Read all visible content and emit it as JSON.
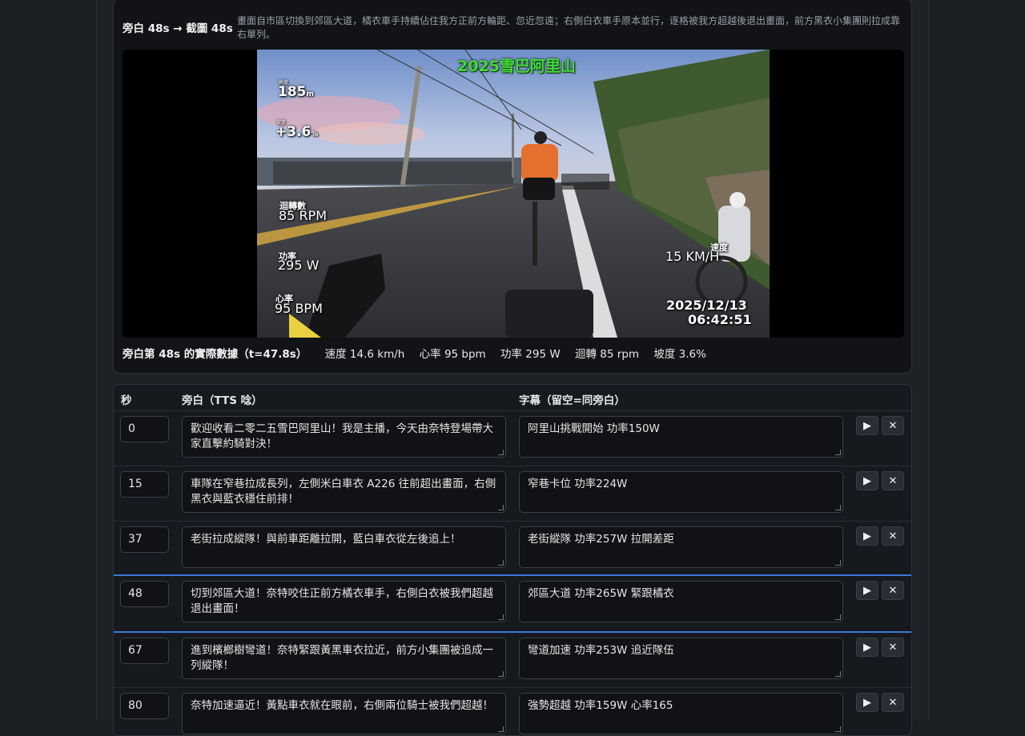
{
  "preview": {
    "title": "旁白 48s → 截圖 48s",
    "description": "畫面自市區切換到郊區大道，橘衣車手持續佔住我方正前方輪距、忽近忽遠；右側白衣車手原本並行，逐格被我方超越後退出畫面，前方黑衣小集團則拉成靠右單列。",
    "overlay": {
      "event_title": "2025雪巴阿里山",
      "altitude_label": "高度",
      "altitude_value": "185",
      "altitude_unit": "m",
      "grade_label": "坡度",
      "grade_value": "+3.6",
      "grade_unit": "%",
      "cadence_label": "迴轉數",
      "cadence_value": "85",
      "cadence_unit": "RPM",
      "power_label": "功率",
      "power_value": "295",
      "power_unit": "W",
      "hr_label": "心率",
      "hr_value": "95",
      "hr_unit": "BPM",
      "speed_label": "速度",
      "speed_value": "15",
      "speed_unit": "KM/H",
      "date": "2025/12/13",
      "time": "06:42:51"
    },
    "actual": {
      "label": "旁白第 48s 的實際數據（t=47.8s）",
      "speed": "速度 14.6 km/h",
      "hr": "心率 95 bpm",
      "power": "功率 295 W",
      "cadence": "迴轉 85 rpm",
      "grade": "坡度 3.6%"
    }
  },
  "table": {
    "headers": {
      "sec": "秒",
      "narration": "旁白（TTS 唸）",
      "subtitle": "字幕（留空=同旁白）"
    },
    "play_icon": "▶",
    "delete_icon": "✕",
    "rows": [
      {
        "sec": "0",
        "narration": "歡迎收看二零二五雪巴阿里山！我是主播，今天由奈特登場帶大家直擊約騎對決！",
        "subtitle": "阿里山挑戰開始 功率150W"
      },
      {
        "sec": "15",
        "narration": "車隊在窄巷拉成長列，左側米白車衣 A226 往前超出畫面，右側黑衣與藍衣穩住前排！",
        "subtitle": "窄巷卡位 功率224W"
      },
      {
        "sec": "37",
        "narration": "老街拉成縱隊！與前車距離拉開，藍白車衣從左後追上！",
        "subtitle": "老街縱隊 功率257W 拉開差距"
      },
      {
        "sec": "48",
        "narration": "切到郊區大道！奈特咬住正前方橘衣車手，右側白衣被我們超越退出畫面！",
        "subtitle": "郊區大道 功率265W 緊跟橘衣"
      },
      {
        "sec": "67",
        "narration": "進到檳榔樹彎道！奈特緊跟黃黑車衣拉近，前方小集團被追成一列縱隊！",
        "subtitle": "彎道加速 功率253W 追近隊伍"
      },
      {
        "sec": "80",
        "narration": "奈特加速逼近！黃點車衣就在眼前，右側兩位騎士被我們超越！",
        "subtitle": "強勢超越 功率159W 心率165"
      }
    ]
  }
}
